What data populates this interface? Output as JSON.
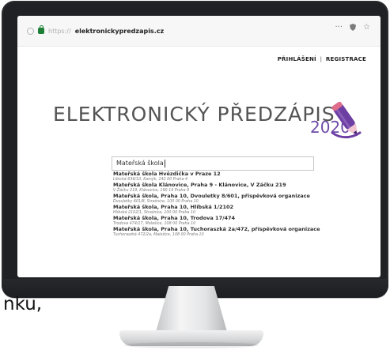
{
  "browser": {
    "url_prefix": "https://",
    "url_domain": "elektronickypredzapis.cz",
    "menu_glyph": "···",
    "star_glyph": "☆"
  },
  "header": {
    "login": "PŘIHLÁŠENÍ",
    "separator": "|",
    "register": "REGISTRACE"
  },
  "site": {
    "title": "ELEKTRONICKÝ PŘEDZÁPIS",
    "year": "2020"
  },
  "search": {
    "value": "Mateřská škola"
  },
  "results": [
    {
      "title": "Mateřská škola Hvězdička v Praze 12",
      "subtitle": "Libická 636/10, Kamýk, 142 00 Praha 4"
    },
    {
      "title": "Mateřská škola Klánovice, Praha 9 - Klánovice, V Žáčku 219",
      "subtitle": "V Žáčku 219, Klánovice, 190 14 Praha 9"
    },
    {
      "title": "Mateřská škola, Praha 10, Dvouletky 8/601, příspěvková organizace",
      "subtitle": "Dvouletky 601/8, Strašnice, 100 00 Praha 10"
    },
    {
      "title": "Mateřská škola, Praha 10, Hlíbská 1/2102",
      "subtitle": "Hlíbská 2102/1, Strašnice, 100 00 Praha 10"
    },
    {
      "title": "Mateřská škola, Praha 10, Trodova 17/474",
      "subtitle": "Trodova 474/17, Malešice, 108 00 Praha 10"
    },
    {
      "title": "Mateřská škola, Praha 10, Tuchoraszká 2a/472, příspěvková organizace",
      "subtitle": "Tuchoraszká 472/2a, Malešice, 108 00 Praha 10"
    }
  ],
  "outside_text": "nku,"
}
